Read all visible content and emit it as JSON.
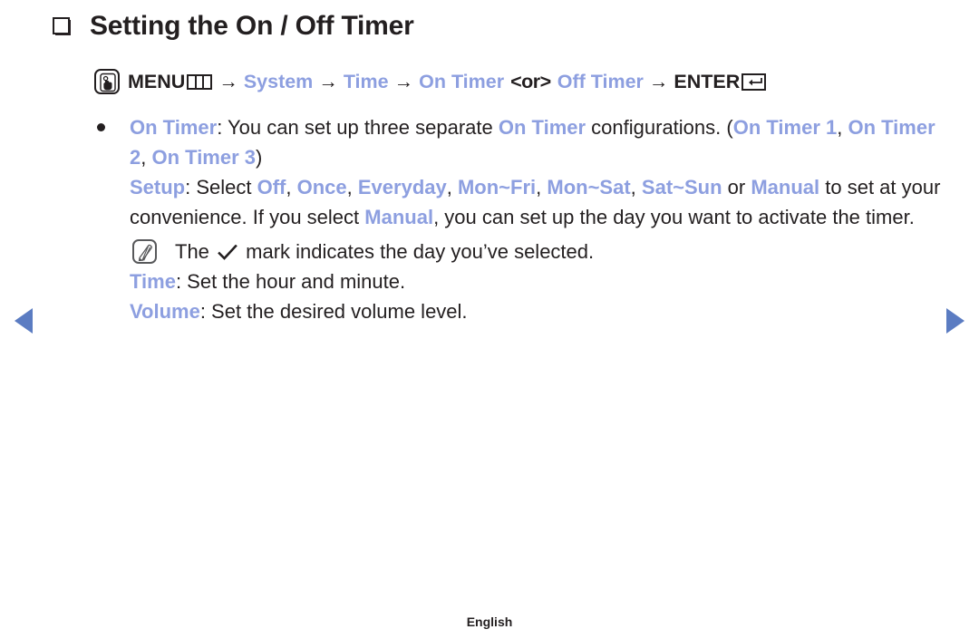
{
  "page": {
    "title": "Setting the On / Off Timer",
    "footer_language": "English",
    "accent_color": "#8d9fe0",
    "text_color": "#231f20",
    "arrow_color": "#5b7cc2"
  },
  "menu_path": {
    "button_icon": "hand-press-button-icon",
    "menu_label": "MENU",
    "menu_grid_icon": "menu-grid-icon",
    "arrow": "→",
    "step_system": "System",
    "step_time": "Time",
    "step_on_timer": "On Timer",
    "or_tag": "<or>",
    "step_off_timer": "Off Timer",
    "enter_label": "ENTER",
    "enter_icon": "enter-return-icon"
  },
  "content": {
    "bullet_symbol": "•",
    "on_timer": {
      "label": "On Timer",
      "text_1": ": You can set up three separate ",
      "label_inline": "On Timer",
      "text_2": " configurations. (",
      "variants": [
        "On Timer 1",
        "On Timer 2",
        "On Timer 3"
      ],
      "close_paren": ")",
      "comma": ", "
    },
    "setup": {
      "label": "Setup",
      "text_1": ": Select ",
      "options": [
        "Off",
        "Once",
        "Everyday",
        "Mon~Fri",
        "Mon~Sat",
        "Sat~Sun"
      ],
      "separator": ", ",
      "text_or": " or ",
      "manual_label": "Manual",
      "text_2": " to set at your convenience. If you select ",
      "manual_label_2": "Manual",
      "text_3": ", you can set up the day you want to activate the timer."
    },
    "note": {
      "icon": "note-pencil-icon",
      "text_1": "The ",
      "check_icon": "check-mark-icon",
      "text_2": " mark indicates the day you’ve selected."
    },
    "time": {
      "label": "Time",
      "text": ": Set the hour and minute."
    },
    "volume": {
      "label": "Volume",
      "text": ": Set the desired volume level."
    }
  },
  "navigation": {
    "prev_label": "previous-page",
    "next_label": "next-page"
  }
}
